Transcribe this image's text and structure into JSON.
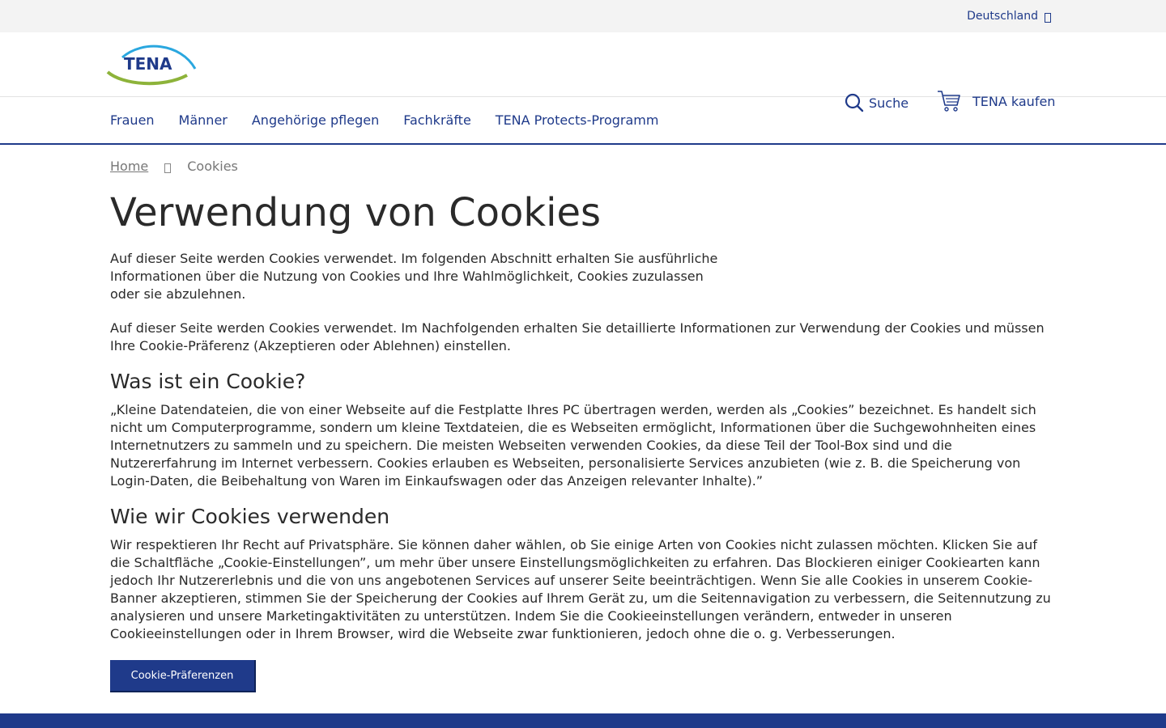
{
  "topbar": {
    "language": "Deutschland"
  },
  "header": {
    "logo_text": "TENA",
    "search_label": "Suche",
    "buy_label": "TENA kaufen"
  },
  "nav": {
    "items": [
      "Frauen",
      "Männer",
      "Angehörige pflegen",
      "Fachkräfte",
      "TENA Protects-Programm"
    ]
  },
  "breadcrumb": {
    "home": "Home",
    "current": "Cookies"
  },
  "main": {
    "title": "Verwendung von Cookies",
    "intro": "Auf dieser Seite werden Cookies verwendet. Im folgenden Abschnitt erhalten Sie ausführliche Informationen über die Nutzung von Cookies und Ihre Wahlmöglichkeit, Cookies zuzulassen oder sie abzulehnen.",
    "para2": "Auf dieser Seite werden Cookies verwendet. Im Nachfolgenden erhalten Sie detaillierte Informationen zur Verwendung der Cookies und müssen Ihre Cookie-Präferenz (Akzeptieren oder Ablehnen) einstellen.",
    "h2_what": "Was ist ein Cookie?",
    "para3": "„Kleine Datendateien, die von einer Webseite auf die Festplatte Ihres PC übertragen werden, werden als „Cookies” bezeichnet. Es handelt sich nicht um Computerprogramme, sondern um kleine Textdateien, die es Webseiten ermöglicht, Informationen über die Suchgewohnheiten eines Internetnutzers zu sammeln und zu speichern. Die meisten Webseiten verwenden Cookies, da diese Teil der Tool-Box sind und die Nutzererfahrung im Internet verbessern. Cookies erlauben es Webseiten, personalisierte Services anzubieten (wie z. B. die Speicherung von Login-Daten, die Beibehaltung von Waren im Einkaufswagen oder das Anzeigen relevanter Inhalte).”",
    "h2_how": "Wie wir Cookies verwenden",
    "para4": "Wir respektieren Ihr Recht auf Privatsphäre. Sie können daher wählen, ob Sie einige Arten von Cookies nicht zulassen möchten. Klicken Sie auf die Schaltfläche „Cookie-Einstellungen”, um mehr über unsere Einstellungsmöglichkeiten zu erfahren. Das Blockieren einiger Cookiearten kann jedoch Ihr Nutzererlebnis und die von uns angebotenen Services auf unserer Seite beeinträchtigen. Wenn Sie alle Cookies in unserem Cookie-Banner akzeptieren, stimmen Sie der Speicherung der Cookies auf Ihrem Gerät zu, um die Seitennavigation zu verbessern, die Seitennutzung zu analysieren und unsere Marketingaktivitäten zu unterstützen. Indem Sie die Cookieeinstellungen verändern, entweder in unseren Cookieeinstellungen oder in Ihrem Browser, wird die Webseite zwar funktionieren, jedoch ohne die o. g. Verbesserungen.",
    "button": "Cookie-Präferenzen"
  },
  "colors": {
    "brand": "#1f3a8a",
    "topbar": "#f3f3f3",
    "logo_green": "#8db33a",
    "logo_blue": "#2aa7df"
  }
}
